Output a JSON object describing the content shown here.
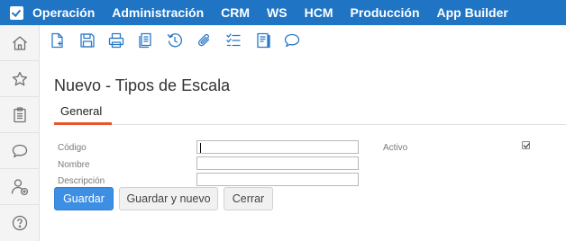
{
  "nav": {
    "brand_icon": "brand-check-icon",
    "menu": [
      "Operación",
      "Administración",
      "CRM",
      "WS",
      "HCM",
      "Producción",
      "App Builder"
    ],
    "color": "#1f74c4"
  },
  "sidebar": {
    "icons": [
      "home-icon",
      "star-icon",
      "clipboard-icon",
      "chat-icon",
      "user-add-icon",
      "help-icon"
    ]
  },
  "toolbar": {
    "icons": [
      "new-document-icon",
      "save-icon",
      "print-icon",
      "documents-icon",
      "history-icon",
      "attach-icon",
      "checklist-icon",
      "notes-icon",
      "comment-icon"
    ]
  },
  "page": {
    "title": "Nuevo - Tipos de Escala"
  },
  "tabs": {
    "active": "General",
    "accent": "#e8542e"
  },
  "form": {
    "codigo_label": "Código",
    "codigo_value": "",
    "nombre_label": "Nombre",
    "nombre_value": "",
    "descripcion_label": "Descripción",
    "descripcion_value": "",
    "activo_label": "Activo",
    "activo_checked": true
  },
  "buttons": {
    "save": "Guardar",
    "save_new": "Guardar y nuevo",
    "close": "Cerrar",
    "primary_color": "#3d8fe3"
  }
}
